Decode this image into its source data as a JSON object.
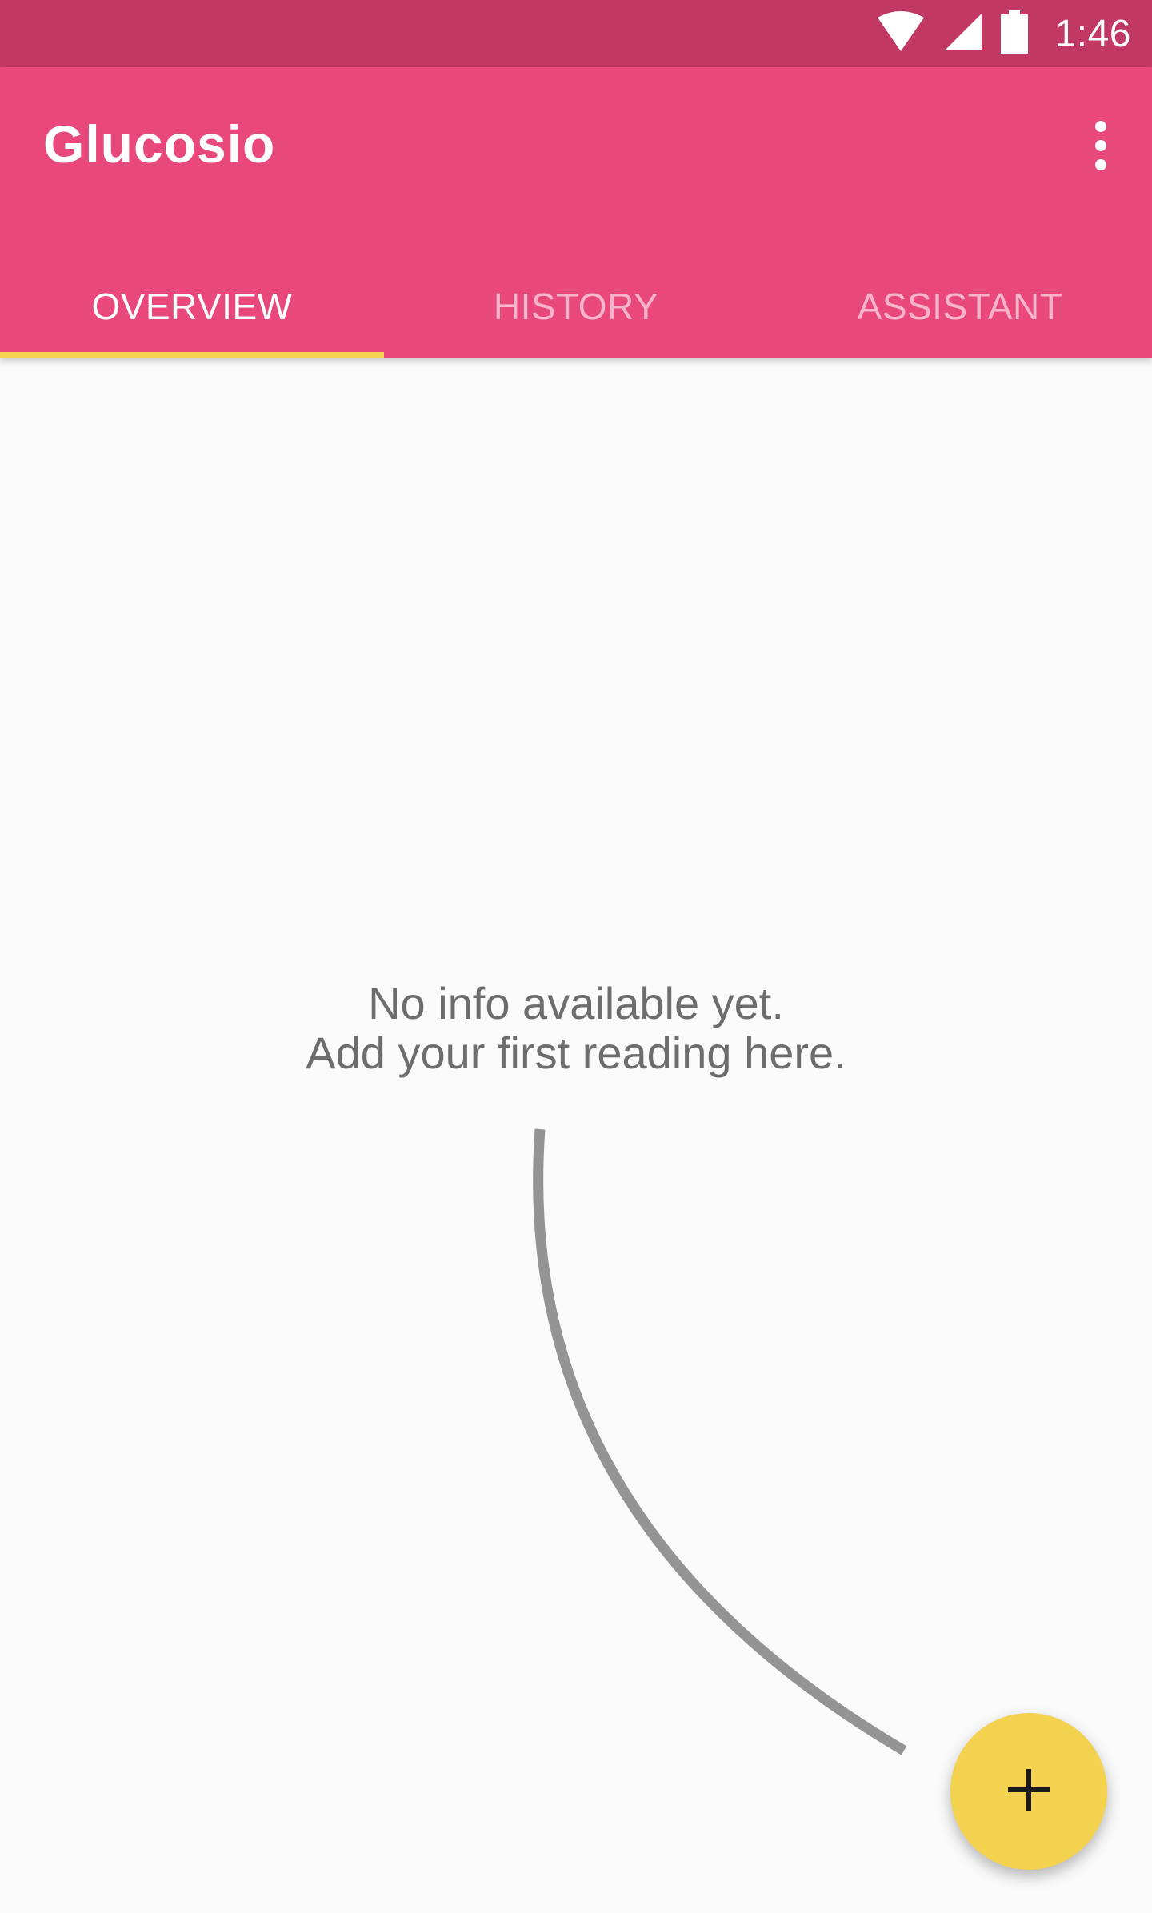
{
  "status_bar": {
    "time": "1:46",
    "icons": [
      "wifi-icon",
      "cellular-signal-icon",
      "battery-icon"
    ]
  },
  "app_bar": {
    "title": "Glucosio",
    "menu_icon": "more-vert-icon"
  },
  "tabs": [
    {
      "label": "OVERVIEW",
      "active": true
    },
    {
      "label": "HISTORY",
      "active": false
    },
    {
      "label": "ASSISTANT",
      "active": false
    }
  ],
  "empty_state": {
    "line1": "No info available yet.",
    "line2": "Add your first reading here."
  },
  "fab": {
    "icon": "plus-icon"
  },
  "colors": {
    "status_bar": "#C13863",
    "primary": "#E8487A",
    "accent": "#F2D24F",
    "tab_indicator": "#F6D54E",
    "background": "#FAFAFA",
    "text_secondary": "#6D6D6D",
    "curve": "#949494"
  }
}
